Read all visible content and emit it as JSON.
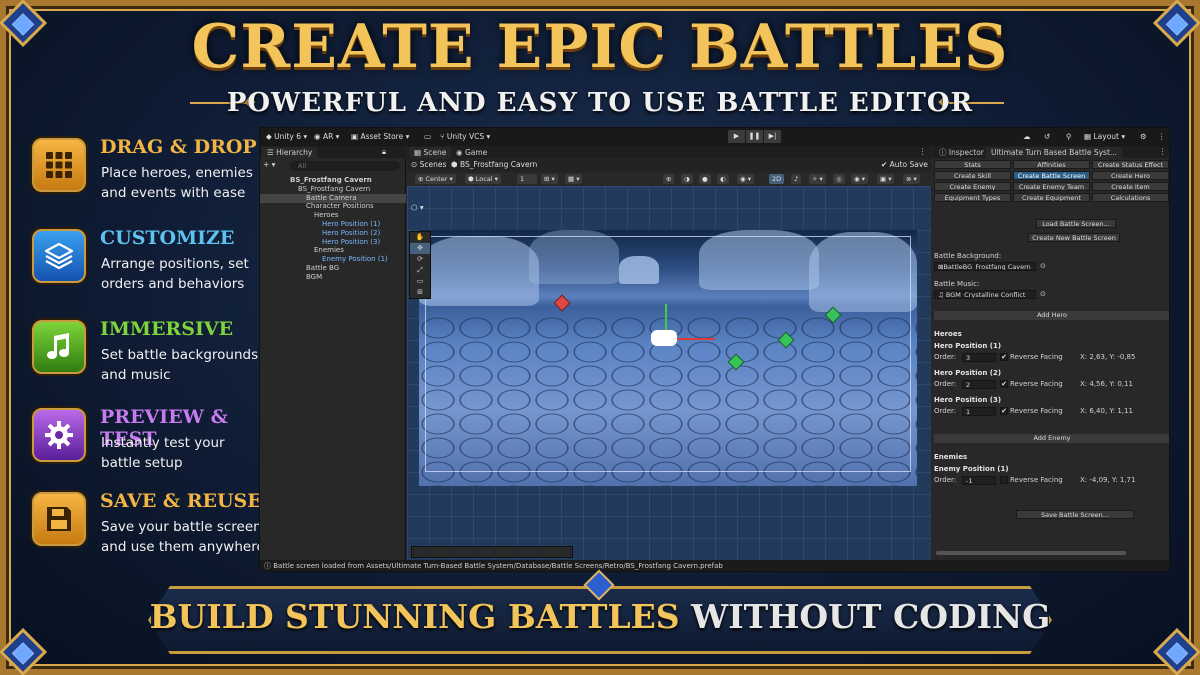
{
  "title": "CREATE EPIC BATTLES",
  "subtitle": "POWERFUL AND EASY TO USE BATTLE EDITOR",
  "banner": {
    "highlight": "BUILD STUNNING BATTLES",
    "rest": "WITHOUT CODING"
  },
  "features": [
    {
      "title": "DRAG & DROP",
      "desc": "Place heroes, enemies and events with ease",
      "icon": "grid-icon",
      "color": "#f2b544"
    },
    {
      "title": "CUSTOMIZE",
      "desc": "Arrange positions, set orders and behaviors",
      "icon": "layers-icon",
      "color": "#5fc3f2"
    },
    {
      "title": "IMMERSIVE",
      "desc": "Set battle backgrounds and music",
      "icon": "music-note-icon",
      "color": "#7fd43a"
    },
    {
      "title": "PREVIEW & TEST",
      "desc": "Instantly test your battle setup",
      "icon": "gear-icon",
      "color": "#c77bef"
    },
    {
      "title": "SAVE & REUSE",
      "desc": "Save your battle screen and use them anywhere",
      "icon": "floppy-disk-icon",
      "color": "#f2b544"
    }
  ],
  "colors": {
    "gold": "#f2c45a",
    "frame": "#d8a94c",
    "editor_bg": "#282828",
    "selected": "#2c5d87",
    "hierarchy_blue": "#7bb6ff"
  },
  "editor": {
    "toolbar": {
      "unity": "Unity 6",
      "ar": "AR",
      "asset_store": "Asset Store",
      "vcs": "Unity VCS",
      "layout": "Layout"
    },
    "hierarchy": {
      "tab": "Hierarchy",
      "search_placeholder": "All",
      "rows": [
        {
          "label": "BS_Frostfang Cavern",
          "indent": 0,
          "bold": true
        },
        {
          "label": "BS_Frostfang Cavern",
          "indent": 1
        },
        {
          "label": "Battle Camera",
          "indent": 2,
          "selected": true
        },
        {
          "label": "Character Positions",
          "indent": 2
        },
        {
          "label": "Heroes",
          "indent": 3
        },
        {
          "label": "Hero Position (1)",
          "indent": 4,
          "blue": true
        },
        {
          "label": "Hero Position (2)",
          "indent": 4,
          "blue": true
        },
        {
          "label": "Hero Position (3)",
          "indent": 4,
          "blue": true
        },
        {
          "label": "Enemies",
          "indent": 3
        },
        {
          "label": "Enemy Position (1)",
          "indent": 4,
          "blue": true
        },
        {
          "label": "Battle BG",
          "indent": 2
        },
        {
          "label": "BGM",
          "indent": 2
        }
      ]
    },
    "scene": {
      "tab_scene": "Scene",
      "tab_game": "Game",
      "breadcrumb_scenes": "Scenes",
      "breadcrumb_prefab": "BS_Frostfang Cavern",
      "auto_save": "Auto Save",
      "pivot": "Center",
      "space": "Local",
      "snap": "1",
      "mode_2d": "2D"
    },
    "inspector": {
      "tab_inspector": "Inspector",
      "tab_window": "Ultimate Turn Based Battle Syst...",
      "tabs": [
        "Stats",
        "Affinities",
        "Create Status Effect",
        "Create Skill",
        "Create Battle Screen",
        "Create Hero",
        "Create Enemy",
        "Create Enemy Team",
        "Create Item",
        "Equipment Types",
        "Create Equipment",
        "Calculations"
      ],
      "selected_tab": "Create Battle Screen",
      "load_btn": "Load Battle Screen...",
      "new_btn": "Create New Battle Screen",
      "bg_label": "Battle Background:",
      "bg_value": "BattleBG_Frostfang Cavern",
      "music_label": "Battle Music:",
      "music_value": "BGM_Crystalline Conflict",
      "add_hero": "Add Hero",
      "heroes_header": "Heroes",
      "order_label": "Order:",
      "reverse_label": "Reverse Facing",
      "heroes": [
        {
          "name": "Hero Position (1)",
          "order": "3",
          "reverse": true,
          "coords": "X: 2,63, Y: -0,85"
        },
        {
          "name": "Hero Position (2)",
          "order": "2",
          "reverse": true,
          "coords": "X: 4,56, Y: 0,11"
        },
        {
          "name": "Hero Position (3)",
          "order": "1",
          "reverse": true,
          "coords": "X: 6,40, Y: 1,11"
        }
      ],
      "add_enemy": "Add Enemy",
      "enemies_header": "Enemies",
      "enemies": [
        {
          "name": "Enemy Position (1)",
          "order": "-1",
          "reverse": false,
          "coords": "X: -4,09, Y: 1,71"
        }
      ],
      "save_btn": "Save Battle Screen..."
    },
    "status": "Battle screen loaded from Assets/Ultimate Turn-Based Battle System/Database/Battle Screens/Retro/BS_Frostfang Cavern.prefab"
  }
}
